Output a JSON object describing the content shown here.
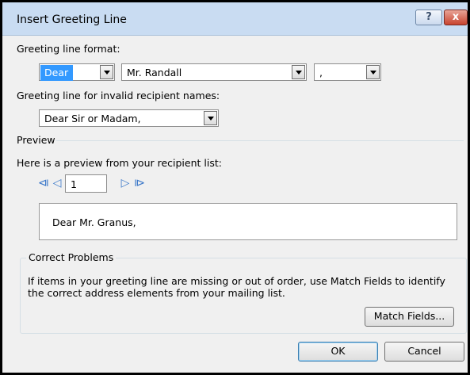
{
  "window": {
    "title": "Insert Greeting Line",
    "help_label": "?",
    "close_label": "x"
  },
  "greeting_format": {
    "label": "Greeting line format:",
    "salutation": "Dear",
    "name_format": "Mr. Randall",
    "punctuation": ","
  },
  "invalid_names": {
    "label": "Greeting line for invalid recipient names:",
    "value": "Dear Sir or Madam,"
  },
  "preview": {
    "section_label": "Preview",
    "description": "Here is a preview from your recipient list:",
    "record_number": "1",
    "text": "Dear Mr. Granus,"
  },
  "correct_problems": {
    "title": "Correct Problems",
    "message": "If items in your greeting line are missing or out of order, use Match Fields to identify the correct address elements from your mailing list.",
    "match_fields_label": "Match Fields..."
  },
  "footer": {
    "ok_label": "OK",
    "cancel_label": "Cancel"
  },
  "colors": {
    "selection": "#3399ff",
    "nav_arrow": "#3b78c9",
    "close_button": "#c8442f"
  },
  "icons": {
    "first": "first-record-icon",
    "previous": "previous-record-icon",
    "next": "next-record-icon",
    "last": "last-record-icon"
  }
}
